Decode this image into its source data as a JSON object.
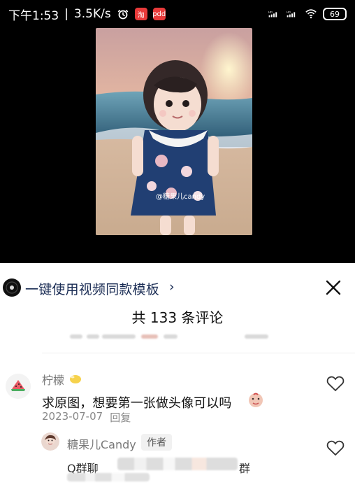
{
  "status_bar": {
    "time": "下午1:53",
    "speed": "3.5K/s",
    "app_badge_1": "淘",
    "app_badge_2": "pdd",
    "network_label_1": "HD",
    "network_label_2": "HD",
    "battery": "69",
    "icons": [
      "alarm-icon",
      "taobao-badge-icon",
      "pdd-badge-icon",
      "signal-icon",
      "wifi-icon",
      "battery-icon"
    ]
  },
  "video": {
    "watermark": "@糖果儿candy"
  },
  "comments_panel": {
    "template_cta": "一键使用视频同款模板",
    "template_icon": "disc-icon",
    "close_icon": "close-icon",
    "count_label": "共 133 条评论",
    "first_comment": {
      "username": "柠檬",
      "text": "求原图，想要第一张做头像可以吗",
      "date": "2023-07-07",
      "reply_label": "回复",
      "avatar_icon": "watermelon-avatar-icon",
      "badge_icon": "lemon-icon",
      "sticker_icon": "face-sticker-icon",
      "like_icon": "heart-icon"
    },
    "reply": {
      "username": "糖果儿Candy",
      "role_badge": "作者",
      "text_prefix": "Q群聊",
      "text_suffix": "群",
      "avatar_icon": "girl-avatar-icon",
      "like_icon": "heart-icon"
    }
  },
  "colors": {
    "background": "#000000",
    "sheet": "#ffffff",
    "cta_text": "#1b2d55",
    "meta_text": "#888888"
  }
}
